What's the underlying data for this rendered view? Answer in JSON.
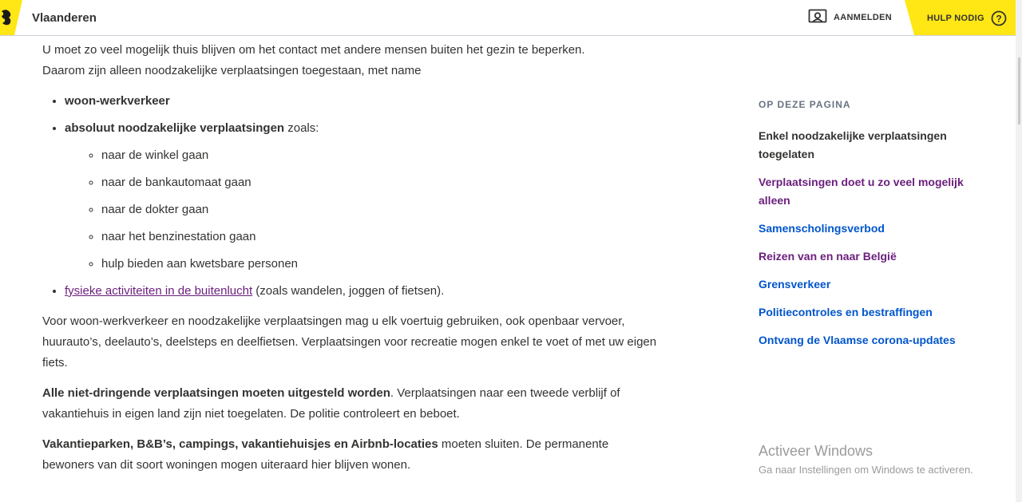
{
  "header": {
    "brand": "Vlaanderen",
    "login_label": "AANMELDEN",
    "help_label": "HULP NODIG",
    "accent_color": "#ffe615",
    "icons": {
      "logo": "flemish-lion-icon",
      "login": "id-card-icon",
      "help": "question-circle-icon"
    }
  },
  "main": {
    "intro_line1": "U moet zo veel mogelijk thuis blijven om het contact met andere mensen buiten het gezin te beperken.",
    "intro_line2": "Daarom zijn alleen noodzakelijke verplaatsingen toegestaan, met name",
    "bullets": {
      "item1": "woon-werkverkeer",
      "item2_bold": "absoluut noodzakelijke verplaatsingen",
      "item2_rest": " zoals:",
      "sub": [
        "naar de winkel gaan",
        "naar de bankautomaat gaan",
        "naar de dokter gaan",
        "naar het benzinestation gaan",
        "hulp bieden aan kwetsbare personen"
      ],
      "item3_link": "fysieke activiteiten in de buitenlucht",
      "item3_rest": " (zoals wandelen, joggen of fietsen)."
    },
    "para2": "Voor woon-werkverkeer en noodzakelijke verplaatsingen mag u elk voertuig gebruiken, ook openbaar vervoer, huurauto’s, deelauto’s, deelsteps en deelfietsen. Verplaatsingen voor recreatie mogen enkel te voet of met uw eigen fiets.",
    "para3_bold": "Alle niet-dringende verplaatsingen moeten uitgesteld worden",
    "para3_rest": ". Verplaatsingen naar een tweede verblijf of vakantiehuis in eigen land zijn niet toegelaten. De politie controleert en beboet.",
    "para4_bold": "Vakantieparken, B&B’s, campings, vakantiehuisjes en Airbnb-locaties",
    "para4_rest": " moeten sluiten. De permanente bewoners van dit soort woningen mogen uiteraard hier blijven wonen."
  },
  "sidebar": {
    "heading": "OP DEZE PAGINA",
    "items": [
      "Enkel noodzakelijke verplaatsingen toegelaten",
      "Verplaatsingen doet u zo veel mogelijk alleen",
      "Samenscholingsverbod",
      "Reizen van en naar België",
      "Grensverkeer",
      "Politiecontroles en bestraffingen",
      "Ontvang de Vlaamse corona-updates"
    ]
  },
  "watermark": {
    "title": "Activeer Windows",
    "subtitle": "Ga naar Instellingen om Windows te activeren."
  }
}
